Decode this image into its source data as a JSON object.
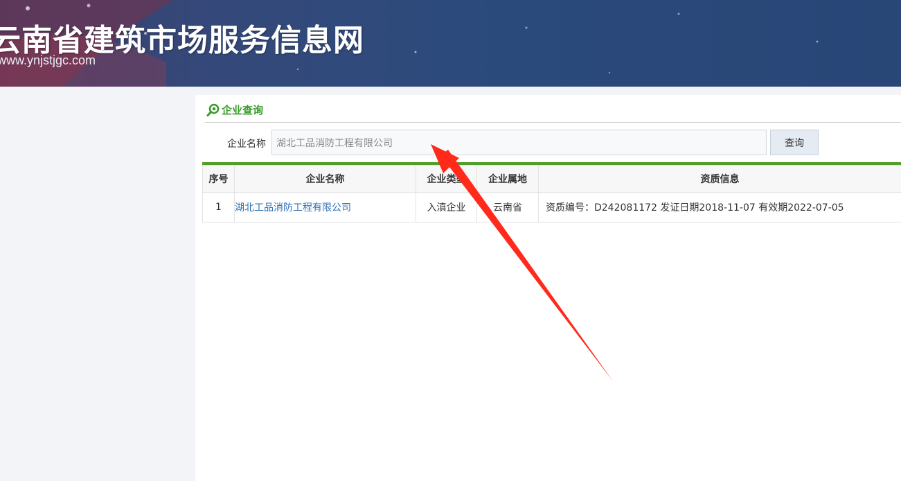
{
  "header": {
    "site_title": "云南省建筑市场服务信息网",
    "site_url": "www.ynjstjgc.com"
  },
  "panel": {
    "title": "企业查询",
    "icon": "search-icon"
  },
  "search": {
    "label": "企业名称",
    "value": "湖北工品消防工程有限公司",
    "button_label": "查询"
  },
  "table": {
    "columns": [
      "序号",
      "企业名称",
      "企业类型",
      "企业属地",
      "资质信息"
    ],
    "rows": [
      {
        "index": "1",
        "name": "湖北工品消防工程有限公司",
        "type": "入滇企业",
        "location": "云南省",
        "qualification": "资质编号：D242081172 发证日期2018-11-07 有效期2022-07-05"
      }
    ]
  },
  "colors": {
    "accent_green": "#4f9e2a",
    "title_green": "#3a9a2c",
    "link_blue": "#2f6fb4",
    "banner_blue": "#2b4a7c",
    "annotation_red": "#ff2a1a"
  }
}
